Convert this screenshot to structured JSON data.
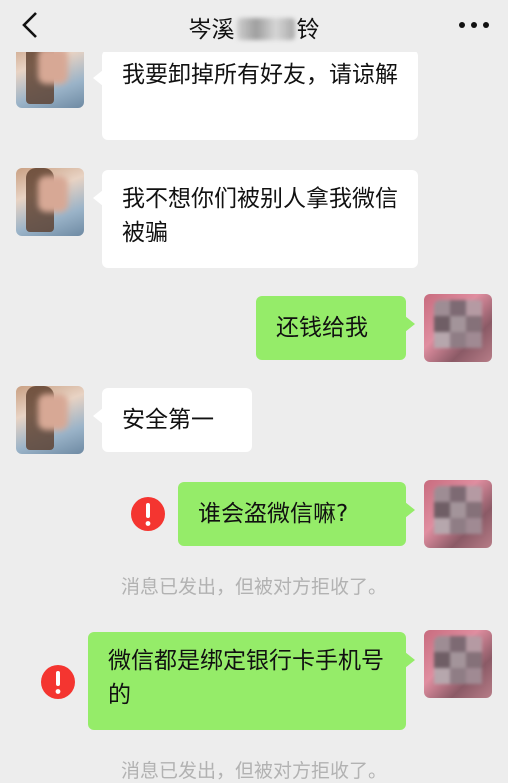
{
  "header": {
    "title_prefix": "岑溪",
    "title_suffix": "铃",
    "back_icon": "chevron-left-icon",
    "more_icon": "more-dots-icon"
  },
  "colors": {
    "background": "#ededed",
    "incoming_bubble": "#ffffff",
    "outgoing_bubble": "#95ec69",
    "error_red": "#f43530",
    "notice_text": "#b2b2b2"
  },
  "messages": [
    {
      "side": "in",
      "text": "我要卸掉所有好友，请谅解"
    },
    {
      "side": "in",
      "text": "我不想你们被别人拿我微信被骗"
    },
    {
      "side": "out",
      "text": "还钱给我"
    },
    {
      "side": "in",
      "text": "安全第一"
    },
    {
      "side": "out",
      "text": "谁会盗微信嘛?",
      "failed": true
    },
    {
      "side": "out",
      "text": "微信都是绑定银行卡手机号的",
      "failed": true
    }
  ],
  "notices": [
    "消息已发出，但被对方拒收了。",
    "消息已发出，但被对方拒收了。"
  ]
}
